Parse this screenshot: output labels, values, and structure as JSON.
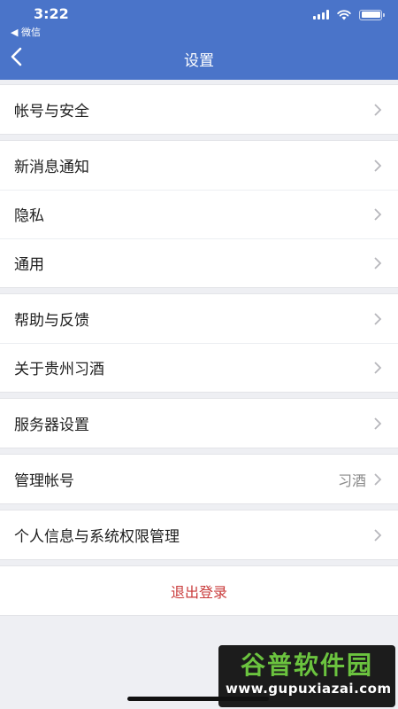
{
  "status_bar": {
    "time": "3:22",
    "back_app": "◀ 微信"
  },
  "nav": {
    "title": "设置"
  },
  "groups": [
    {
      "items": [
        {
          "label": "帐号与安全",
          "value": ""
        }
      ]
    },
    {
      "items": [
        {
          "label": "新消息通知",
          "value": ""
        },
        {
          "label": "隐私",
          "value": ""
        },
        {
          "label": "通用",
          "value": ""
        }
      ]
    },
    {
      "items": [
        {
          "label": "帮助与反馈",
          "value": ""
        },
        {
          "label": "关于贵州习酒",
          "value": ""
        }
      ]
    },
    {
      "items": [
        {
          "label": "服务器设置",
          "value": ""
        }
      ]
    },
    {
      "items": [
        {
          "label": "管理帐号",
          "value": "习酒"
        }
      ]
    },
    {
      "items": [
        {
          "label": "个人信息与系统权限管理",
          "value": ""
        }
      ]
    }
  ],
  "logout": {
    "label": "退出登录"
  },
  "watermark": {
    "name": "谷普软件园",
    "url": "www.gupuxiazai.com"
  },
  "colors": {
    "header_bg": "#4a74c9",
    "logout_text": "#c93b3b",
    "page_bg": "#eeeff3"
  }
}
